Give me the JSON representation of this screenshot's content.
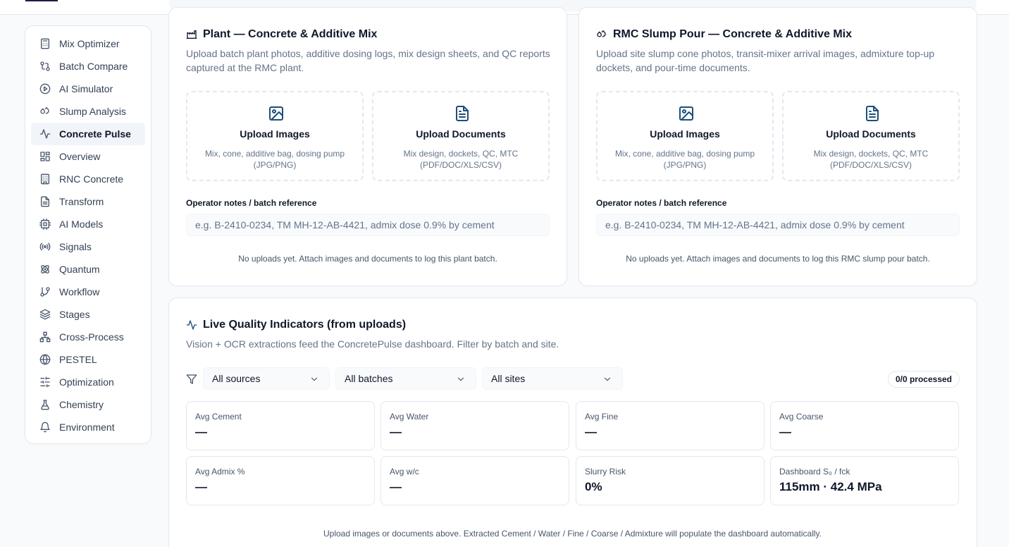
{
  "sidebar": {
    "items": [
      {
        "label": "Mix Optimizer",
        "icon": "calculator-icon",
        "active": false
      },
      {
        "label": "Batch Compare",
        "icon": "git-compare-icon",
        "active": false
      },
      {
        "label": "AI Simulator",
        "icon": "play-circle-icon",
        "active": false
      },
      {
        "label": "Slump Analysis",
        "icon": "droplets-icon",
        "active": false
      },
      {
        "label": "Concrete Pulse",
        "icon": "activity-icon",
        "active": true
      },
      {
        "label": "Overview",
        "icon": "layout-dashboard-icon",
        "active": false
      },
      {
        "label": "RNC Concrete",
        "icon": "building-icon",
        "active": false
      },
      {
        "label": "Transform",
        "icon": "file-text-icon",
        "active": false
      },
      {
        "label": "AI Models",
        "icon": "cpu-icon",
        "active": false
      },
      {
        "label": "Signals",
        "icon": "radio-icon",
        "active": false
      },
      {
        "label": "Quantum",
        "icon": "atom-icon",
        "active": false
      },
      {
        "label": "Workflow",
        "icon": "git-branch-icon",
        "active": false
      },
      {
        "label": "Stages",
        "icon": "layers-icon",
        "active": false
      },
      {
        "label": "Cross-Process",
        "icon": "network-icon",
        "active": false
      },
      {
        "label": "PESTEL",
        "icon": "globe-icon",
        "active": false
      },
      {
        "label": "Optimization",
        "icon": "sliders-icon",
        "active": false
      },
      {
        "label": "Chemistry",
        "icon": "flask-icon",
        "active": false
      },
      {
        "label": "Environment",
        "icon": "bell-icon",
        "active": false
      }
    ]
  },
  "plant": {
    "title": "Plant — Concrete & Additive Mix",
    "icon": "factory-icon",
    "description": "Upload batch plant photos, additive dosing logs, mix design sheets, and QC reports captured at the RMC plant.",
    "upload_images": {
      "title": "Upload Images",
      "subtitle": "Mix, cone, additive bag, dosing pump (JPG/PNG)"
    },
    "upload_documents": {
      "title": "Upload Documents",
      "subtitle": "Mix design, dockets, QC, MTC (PDF/DOC/XLS/CSV)"
    },
    "notes_label": "Operator notes / batch reference",
    "notes_placeholder": "e.g. B-2410-0234, TM MH-12-AB-4421, admix dose 0.9% by cement",
    "empty_note": "No uploads yet. Attach images and documents to log this plant batch."
  },
  "rmc": {
    "title": "RMC Slump Pour — Concrete & Additive Mix",
    "icon": "droplets-icon",
    "description": "Upload site slump cone photos, transit-mixer arrival images, admixture top-up dockets, and pour-time documents.",
    "upload_images": {
      "title": "Upload Images",
      "subtitle": "Mix, cone, additive bag, dosing pump (JPG/PNG)"
    },
    "upload_documents": {
      "title": "Upload Documents",
      "subtitle": "Mix design, dockets, QC, MTC (PDF/DOC/XLS/CSV)"
    },
    "notes_label": "Operator notes / batch reference",
    "notes_placeholder": "e.g. B-2410-0234, TM MH-12-AB-4421, admix dose 0.9% by cement",
    "empty_note": "No uploads yet. Attach images and documents to log this RMC slump pour batch."
  },
  "live": {
    "title": "Live Quality Indicators (from uploads)",
    "icon": "activity-icon",
    "description": "Vision + OCR extractions feed the ConcretePulse dashboard. Filter by batch and site.",
    "filters": {
      "sources": "All sources",
      "batches": "All batches",
      "sites": "All sites"
    },
    "processed": "0/0 processed",
    "metrics": [
      {
        "label": "Avg Cement",
        "value": "—"
      },
      {
        "label": "Avg Water",
        "value": "—"
      },
      {
        "label": "Avg Fine",
        "value": "—"
      },
      {
        "label": "Avg Coarse",
        "value": "—"
      },
      {
        "label": "Avg Admix %",
        "value": "—"
      },
      {
        "label": "Avg w/c",
        "value": "—"
      },
      {
        "label": "Slurry Risk",
        "value": "0%"
      },
      {
        "label": "Dashboard S₀ / fck",
        "value": "115mm · 42.4 MPa"
      }
    ],
    "footnote": "Upload images or documents above. Extracted Cement / Water / Fine / Coarse / Admixture will populate the dashboard automatically."
  },
  "colors": {
    "accent": "#1e4e79",
    "border": "#e2e8f0",
    "muted": "#64748b",
    "active_bg": "#f1f5f9"
  }
}
